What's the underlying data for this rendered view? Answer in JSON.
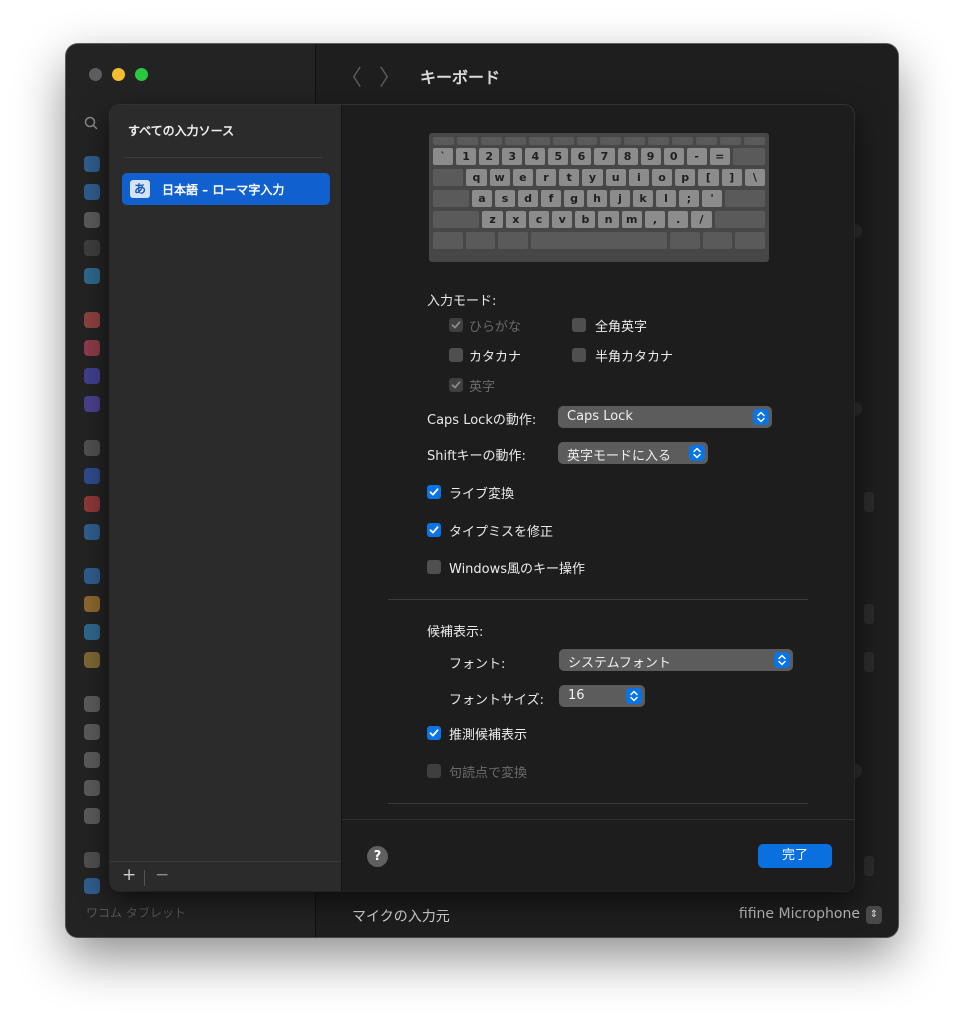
{
  "window": {
    "title": "キーボード",
    "back_glyph": "〈",
    "forward_glyph": "〉"
  },
  "sidebar": {
    "bottom_item": "ワコム タブレット"
  },
  "background": {
    "mic_label": "マイクの入力元",
    "mic_value": "fifine Microphone"
  },
  "sheet": {
    "sources_header": "すべての入力ソース",
    "source": {
      "badge": "あ",
      "label": "日本語 – ローマ字入力"
    },
    "add_glyph": "+",
    "remove_glyph": "−",
    "keyboard": {
      "row1": [
        "`",
        "1",
        "2",
        "3",
        "4",
        "5",
        "6",
        "7",
        "8",
        "9",
        "0",
        "-",
        "="
      ],
      "row2": [
        "q",
        "w",
        "e",
        "r",
        "t",
        "y",
        "u",
        "i",
        "o",
        "p",
        "[",
        "]",
        "\\"
      ],
      "row3": [
        "a",
        "s",
        "d",
        "f",
        "g",
        "h",
        "j",
        "k",
        "l",
        ";",
        "'"
      ],
      "row4": [
        "z",
        "x",
        "c",
        "v",
        "b",
        "n",
        "m",
        ",",
        ".",
        "/"
      ]
    },
    "input_mode": {
      "label": "入力モード:",
      "hiragana": "ひらがな",
      "zenkaku_eiji": "全角英字",
      "katakana": "カタカナ",
      "hankaku_katakana": "半角カタカナ",
      "eiji": "英字"
    },
    "caps_lock": {
      "label": "Caps Lockの動作:",
      "value": "Caps Lock"
    },
    "shift": {
      "label": "Shiftキーの動作:",
      "value": "英字モードに入る"
    },
    "live_conversion": "ライブ変換",
    "typo_fix": "タイプミスを修正",
    "windows_keys": "Windows風のキー操作",
    "candidates": {
      "label": "候補表示:",
      "font_label": "フォント:",
      "font_value": "システムフォント",
      "size_label": "フォントサイズ:",
      "size_value": "16",
      "predictive": "推測候補表示",
      "punctuation": "句読点で変換"
    },
    "help_glyph": "?",
    "done_label": "完了"
  },
  "colors": {
    "accent": "#0a74e6",
    "sheet_bg": "#1d1d1d",
    "sidebar_bg": "#2b2b2b"
  }
}
